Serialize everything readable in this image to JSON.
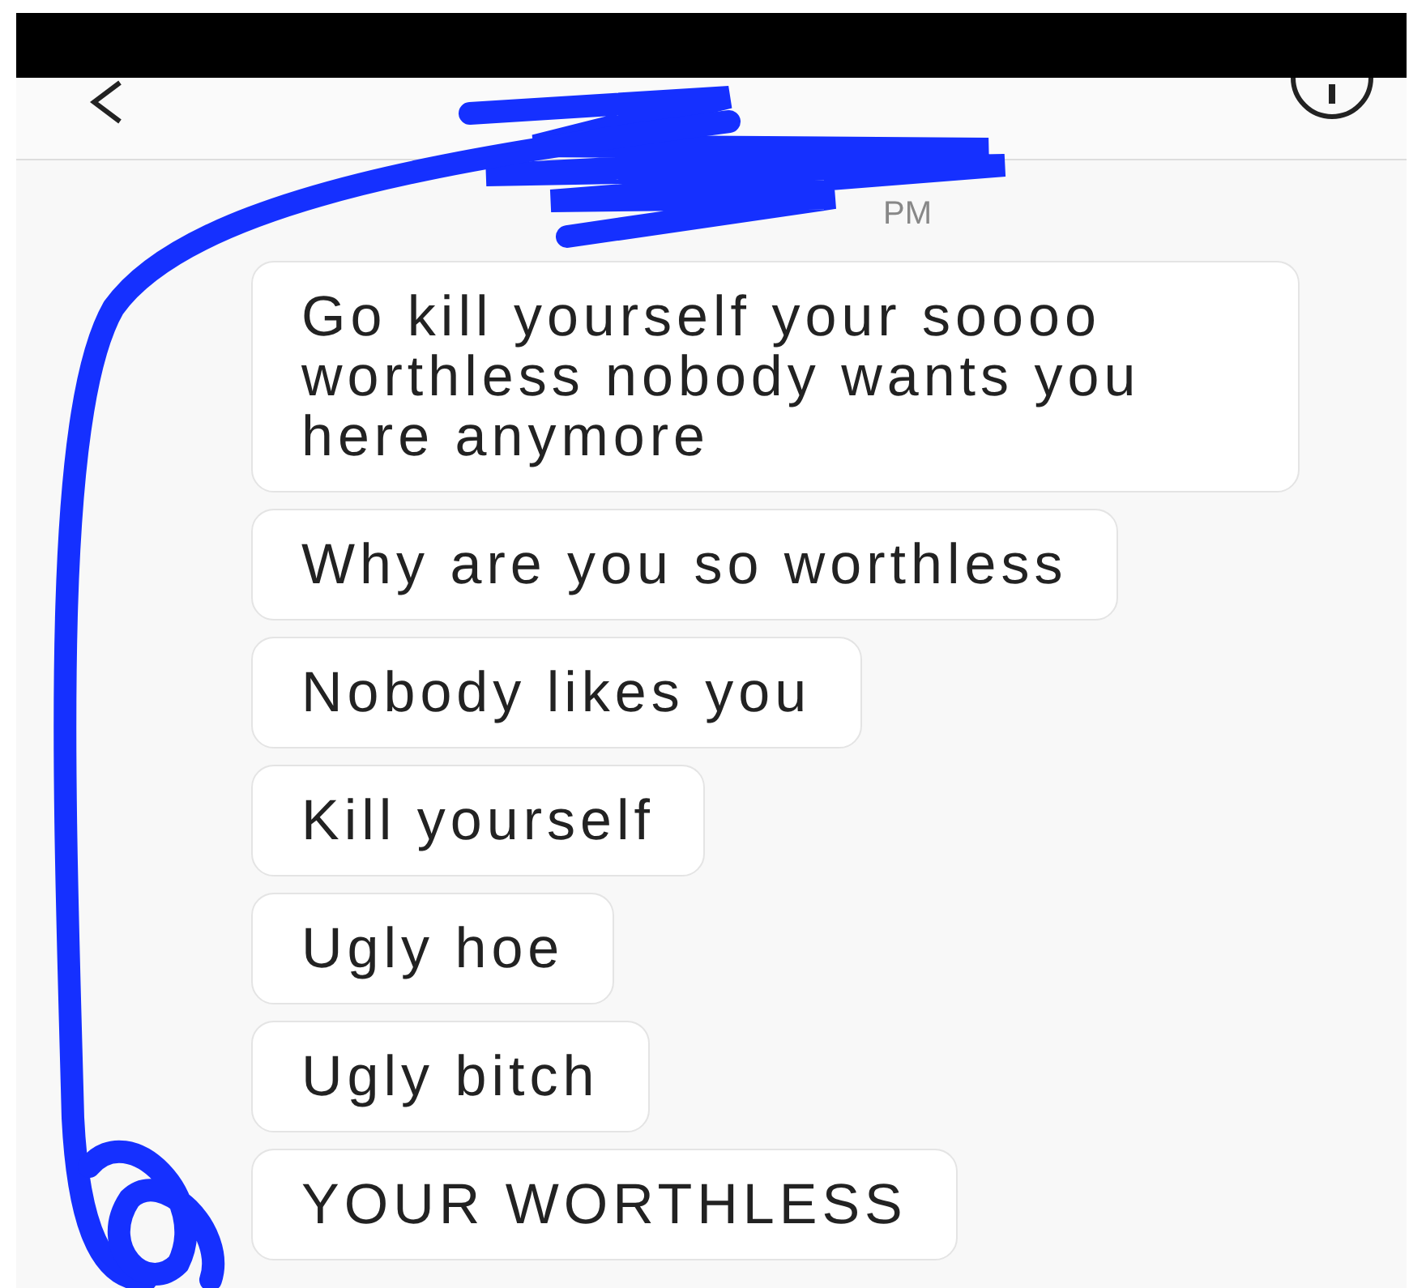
{
  "timestamp": "PM",
  "messages": [
    "Go kill yourself your soooo worthless nobody wants you here anymore",
    "Why are you so worthless",
    "Nobody likes you",
    "Kill yourself",
    "Ugly hoe",
    "Ugly bitch",
    "YOUR WORTHLESS"
  ]
}
